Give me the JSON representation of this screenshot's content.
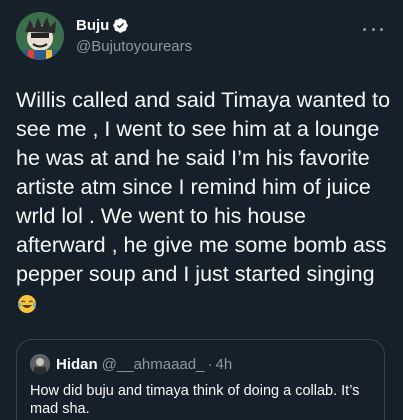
{
  "author": {
    "display_name": "Buju",
    "handle": "@Bujutoyourears",
    "verified": true
  },
  "tweet": {
    "text": "Willis called and said Timaya wanted to see me , I went to see him at a lounge he was at and he said I’m his favorite artiste atm since I remind him of juice wrld lol . We went to his house afterward , he give me some bomb ass pepper soup and I just started singing",
    "emoji": "laughing-tears-emoji"
  },
  "quoted_tweet": {
    "display_name": "Hidan",
    "handle": "@__ahmaaad_",
    "separator": "·",
    "time": "4h",
    "text": "How did buju and timaya think of doing a collab. It’s mad sha."
  },
  "colors": {
    "background": "#15202b",
    "primary_text": "#f7f9f9",
    "secondary_text": "#8b98a5",
    "border": "#38444d",
    "verified_badge": "#ffffff"
  },
  "icons": {
    "more": "more-options-icon",
    "verified": "verified-badge-icon"
  }
}
